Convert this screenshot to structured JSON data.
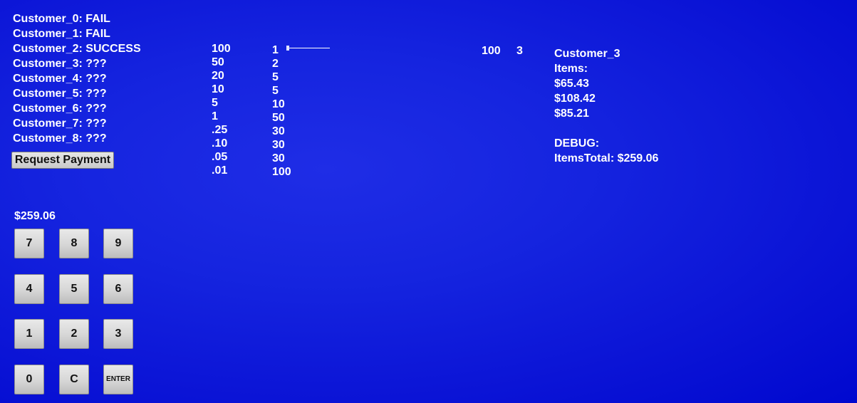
{
  "customers": [
    {
      "name": "Customer_0",
      "status": "FAIL"
    },
    {
      "name": "Customer_1",
      "status": "FAIL"
    },
    {
      "name": "Customer_2",
      "status": "SUCCESS"
    },
    {
      "name": "Customer_3",
      "status": "???"
    },
    {
      "name": "Customer_4",
      "status": "???"
    },
    {
      "name": "Customer_5",
      "status": "???"
    },
    {
      "name": "Customer_6",
      "status": "???"
    },
    {
      "name": "Customer_7",
      "status": "???"
    },
    {
      "name": "Customer_8",
      "status": "???"
    }
  ],
  "request_button": "Request Payment",
  "denominations": [
    "100",
    "50",
    "20",
    "10",
    "5",
    "1",
    ".25",
    ".10",
    ".05",
    ".01"
  ],
  "counts": [
    "1",
    "2",
    "5",
    "5",
    "10",
    "50",
    "30",
    "30",
    "30",
    "100"
  ],
  "slider": {
    "value": 0
  },
  "stats": {
    "a": "100",
    "b": "3"
  },
  "customer_panel": {
    "name": "Customer_3",
    "items_label": "Items:",
    "items": [
      "$65.43",
      "$108.42",
      "$85.21"
    ],
    "debug_label": "DEBUG:",
    "items_total": "ItemsTotal: $259.06"
  },
  "display": "$259.06",
  "keypad": {
    "k7": "7",
    "k8": "8",
    "k9": "9",
    "k4": "4",
    "k5": "5",
    "k6": "6",
    "k1": "1",
    "k2": "2",
    "k3": "3",
    "k0": "0",
    "clear": "C",
    "enter": "ENTER"
  }
}
